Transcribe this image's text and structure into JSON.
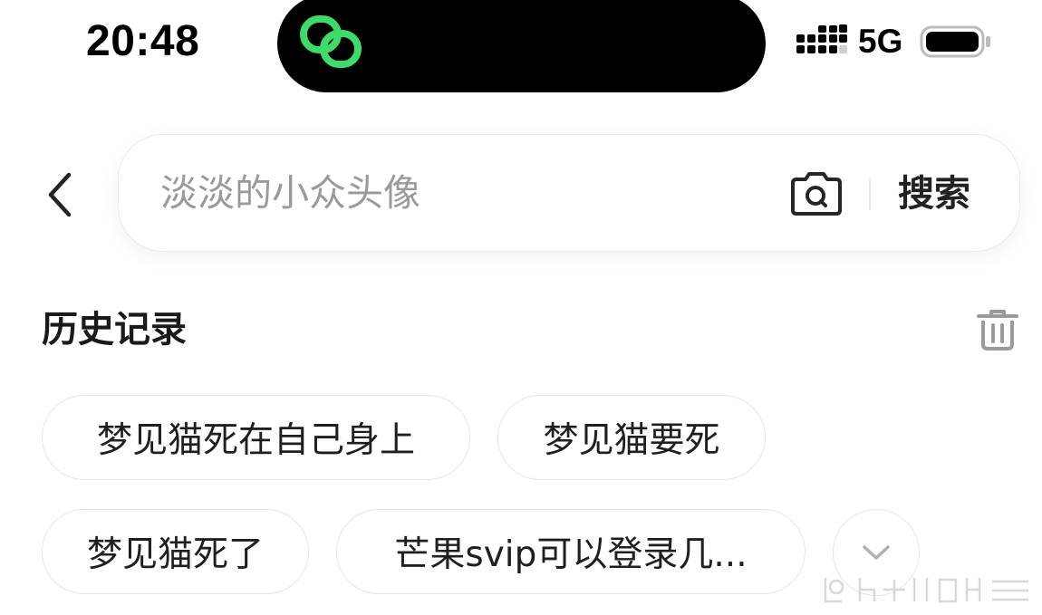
{
  "status_bar": {
    "time": "20:48",
    "network": "5G",
    "island_icon": "link-rings-icon",
    "signal_icon": "signal-dots-icon",
    "battery_icon": "battery-full-icon",
    "island_icon_color": "#3ddc68"
  },
  "search": {
    "placeholder": "淡淡的小众头像",
    "value": "",
    "submit_label": "搜索",
    "back_icon": "chevron-left-icon",
    "camera_icon": "camera-search-icon"
  },
  "history": {
    "title": "历史记录",
    "clear_icon": "trash-icon",
    "items": [
      {
        "label": "梦见猫死在自己身上"
      },
      {
        "label": "梦见猫要死"
      },
      {
        "label": "梦见猫死了"
      },
      {
        "label": "芒果svip可以登录几..."
      }
    ],
    "expand_icon": "chevron-down-icon"
  },
  "colors": {
    "text_primary": "#1a1a1a",
    "placeholder": "#9a9a9a",
    "border": "#e6e6e6",
    "icon_gray": "#9a9a9a"
  }
}
